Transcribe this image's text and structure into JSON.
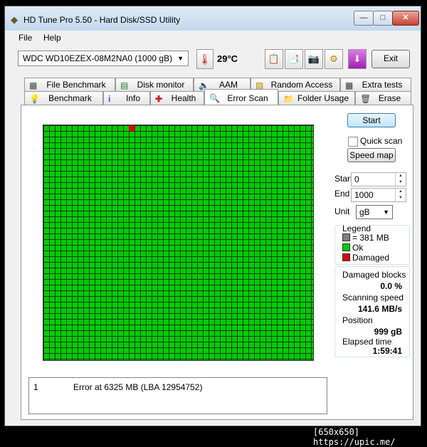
{
  "window": {
    "title": "HD Tune Pro 5.50 - Hard Disk/SSD Utility",
    "minimize": "—",
    "maximize": "□",
    "close": "✕"
  },
  "menu": {
    "file": "File",
    "help": "Help"
  },
  "toolbar": {
    "drive": "WDC WD10EZEX-08M2NA0 (1000 gB)",
    "temperature": "29°C",
    "exit": "Exit"
  },
  "tabs_top": [
    "File Benchmark",
    "Disk monitor",
    "AAM",
    "Random Access",
    "Extra tests"
  ],
  "tabs_bottom": [
    "Benchmark",
    "Info",
    "Health",
    "Error Scan",
    "Folder Usage",
    "Erase"
  ],
  "active_tab": "Error Scan",
  "controls": {
    "start_button": "Start",
    "quick_scan": "Quick scan",
    "quick_scan_checked": false,
    "speed_map": "Speed map",
    "start_label": "Start",
    "start_value": "0",
    "end_label": "End",
    "end_value": "1000",
    "unit_label": "Unit",
    "unit_value": "gB"
  },
  "legend": {
    "title": "Legend",
    "block": "= 381 MB",
    "ok": "Ok",
    "damaged": "Damaged",
    "colors": {
      "block": "#808080",
      "ok": "#00cc00",
      "damaged": "#e00000"
    }
  },
  "stats": {
    "damaged_blocks_label": "Damaged blocks",
    "damaged_blocks": "0.0 %",
    "scanning_speed_label": "Scanning speed",
    "scanning_speed": "141.6 MB/s",
    "position_label": "Position",
    "position": "999 gB",
    "elapsed_label": "Elapsed time",
    "elapsed": "1:59:41"
  },
  "log": [
    {
      "index": "1",
      "message": "Error at 6325 MB (LBA 12954752)"
    }
  ],
  "watermark": "[650x650] https://upic.me/"
}
